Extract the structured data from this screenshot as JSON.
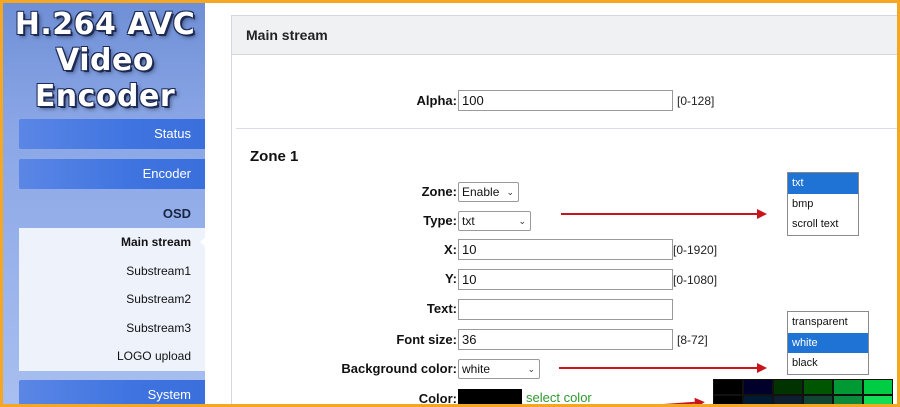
{
  "logo": {
    "line1": "H.264 AVC",
    "line2": "Video Encoder"
  },
  "sidebar": {
    "status": "Status",
    "encoder": "Encoder",
    "osd": "OSD",
    "items": [
      {
        "label": "Main stream"
      },
      {
        "label": "Substream1"
      },
      {
        "label": "Substream2"
      },
      {
        "label": "Substream3"
      },
      {
        "label": "LOGO upload"
      }
    ],
    "system": "System"
  },
  "panel": {
    "title": "Main stream",
    "alpha": {
      "label": "Alpha:",
      "value": "100",
      "range": "[0-128]"
    },
    "zone_title": "Zone 1",
    "zone": {
      "label": "Zone:",
      "value": "Enable"
    },
    "type": {
      "label": "Type:",
      "value": "txt"
    },
    "x": {
      "label": "X:",
      "value": "10",
      "range": "[0-1920]"
    },
    "y": {
      "label": "Y:",
      "value": "10",
      "range": "[0-1080]"
    },
    "text": {
      "label": "Text:",
      "value": ""
    },
    "font_size": {
      "label": "Font size:",
      "value": "36",
      "range": "[8-72]"
    },
    "bg_color": {
      "label": "Background color:",
      "value": "white"
    },
    "color": {
      "label": "Color:",
      "link": "select color"
    }
  },
  "type_popup": {
    "options": [
      "txt",
      "bmp",
      "scroll text"
    ],
    "selected": 0
  },
  "bg_popup": {
    "options": [
      "transparent",
      "white",
      "black"
    ],
    "selected": 1
  },
  "palette": {
    "colors": [
      "#000000",
      "#00002b",
      "#003300",
      "#005500",
      "#009933",
      "#00cc44",
      "#000000",
      "#001a33",
      "#0d1f2f",
      "#124433",
      "#0a8a3a",
      "#11dd55"
    ]
  }
}
